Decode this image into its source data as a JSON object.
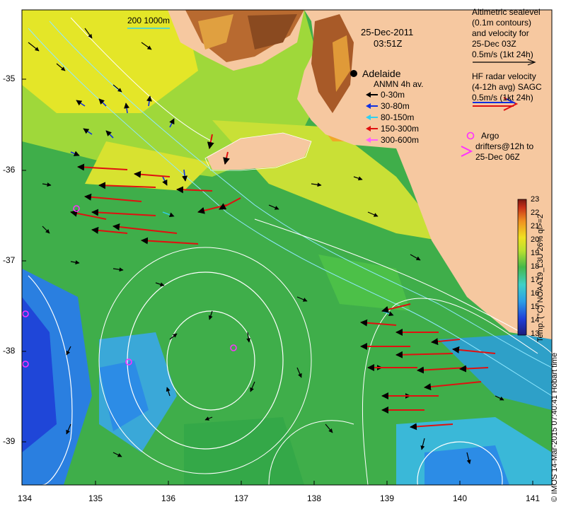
{
  "map": {
    "date": "25-Dec-2011",
    "time": "03:51Z",
    "city": "Adelaide",
    "scale_label": "200  1000m",
    "lon_ticks": [
      "134",
      "135",
      "136",
      "137",
      "138",
      "139",
      "140",
      "141"
    ],
    "lat_ticks": [
      "-35",
      "-36",
      "-37",
      "-38",
      "-39"
    ],
    "land_color": "#f6c8a0",
    "ocean_colors": [
      "#1d3fd8",
      "#2c7ee6",
      "#3fc0e0",
      "#45b84a",
      "#8ed23a",
      "#e7e625",
      "#f0a020",
      "#c85018",
      "#7a2810"
    ]
  },
  "legend": {
    "altimetric": [
      "Altimetric sealevel",
      "(0.1m contours)",
      "and velocity for",
      "25-Dec 03Z",
      "0.5m/s (1kt 24h)"
    ],
    "hf_radar": [
      "HF radar velocity",
      "(4-12h avg) SAGC",
      "0.5m/s (1kt 24h)"
    ],
    "anmn_title": "ANMN 4h av.",
    "anmn_entries": [
      {
        "label": "0-30m",
        "color": "#000000"
      },
      {
        "label": "30-80m",
        "color": "#1030e0"
      },
      {
        "label": "80-150m",
        "color": "#30d0f0"
      },
      {
        "label": "150-300m",
        "color": "#e01010"
      },
      {
        "label": "300-600m",
        "color": "#ff60ff"
      }
    ],
    "argo": [
      "Argo",
      "drifters@12h to",
      "25-Dec 06Z"
    ]
  },
  "colorbar": {
    "title": "Temp. (°C) NOAA19_L3U 26% ql>=2",
    "ticks": [
      "23",
      "22",
      "21",
      "20",
      "19",
      "18",
      "17",
      "16",
      "15",
      "14",
      "13"
    ]
  },
  "credit": "© IMOS 14-Mar-2015 07:40:41 Hobart time"
}
